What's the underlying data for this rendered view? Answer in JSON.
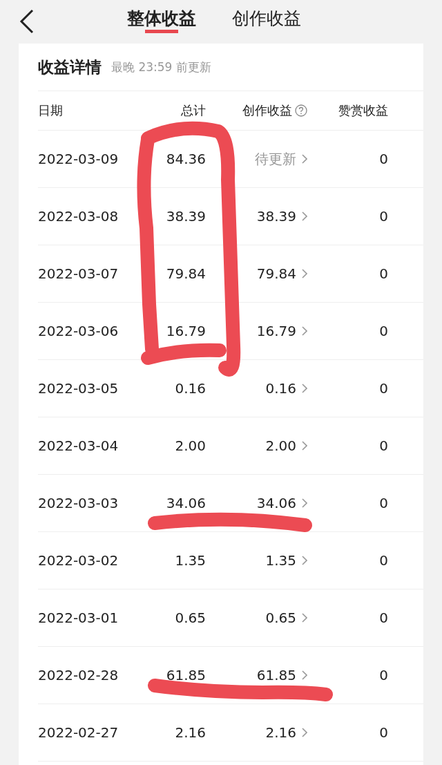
{
  "nav": {
    "tabs": [
      {
        "label": "整体收益",
        "selected": true
      },
      {
        "label": "创作收益",
        "selected": false
      }
    ]
  },
  "card": {
    "title": "收益详情",
    "note": "最晚 23:59 前更新",
    "columns": [
      "日期",
      "总计",
      "创作收益",
      "赞赏收益"
    ],
    "rows": [
      {
        "date": "2022-03-09",
        "total": "84.36",
        "creation": "待更新",
        "pending": true,
        "reward": "0"
      },
      {
        "date": "2022-03-08",
        "total": "38.39",
        "creation": "38.39",
        "pending": false,
        "reward": "0"
      },
      {
        "date": "2022-03-07",
        "total": "79.84",
        "creation": "79.84",
        "pending": false,
        "reward": "0"
      },
      {
        "date": "2022-03-06",
        "total": "16.79",
        "creation": "16.79",
        "pending": false,
        "reward": "0"
      },
      {
        "date": "2022-03-05",
        "total": "0.16",
        "creation": "0.16",
        "pending": false,
        "reward": "0"
      },
      {
        "date": "2022-03-04",
        "total": "2.00",
        "creation": "2.00",
        "pending": false,
        "reward": "0"
      },
      {
        "date": "2022-03-03",
        "total": "34.06",
        "creation": "34.06",
        "pending": false,
        "reward": "0"
      },
      {
        "date": "2022-03-02",
        "total": "1.35",
        "creation": "1.35",
        "pending": false,
        "reward": "0"
      },
      {
        "date": "2022-03-01",
        "total": "0.65",
        "creation": "0.65",
        "pending": false,
        "reward": "0"
      },
      {
        "date": "2022-02-28",
        "total": "61.85",
        "creation": "61.85",
        "pending": false,
        "reward": "0"
      },
      {
        "date": "2022-02-27",
        "total": "2.16",
        "creation": "2.16",
        "pending": false,
        "reward": "0"
      }
    ]
  }
}
